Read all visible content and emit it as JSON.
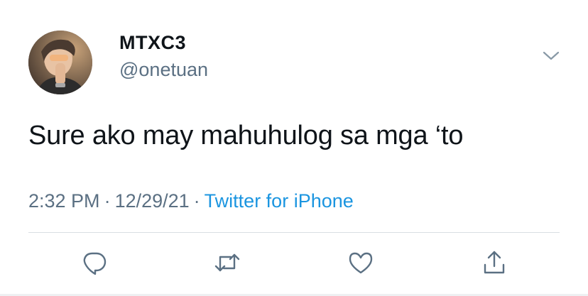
{
  "tweet": {
    "display_name": "MTXC3",
    "handle": "@onetuan",
    "text": "Sure ako may mahuhulog sa mga ‘to",
    "time": "2:32 PM",
    "date": "12/29/21",
    "separator": "·",
    "source": "Twitter for iPhone"
  },
  "icons": {
    "menu": "chevron-down-icon",
    "reply": "reply-icon",
    "retweet": "retweet-icon",
    "like": "heart-icon",
    "share": "share-icon"
  },
  "colors": {
    "text_primary": "#0f1419",
    "text_secondary": "#5b7083",
    "link": "#1b95e0",
    "divider": "#d9dee3"
  }
}
